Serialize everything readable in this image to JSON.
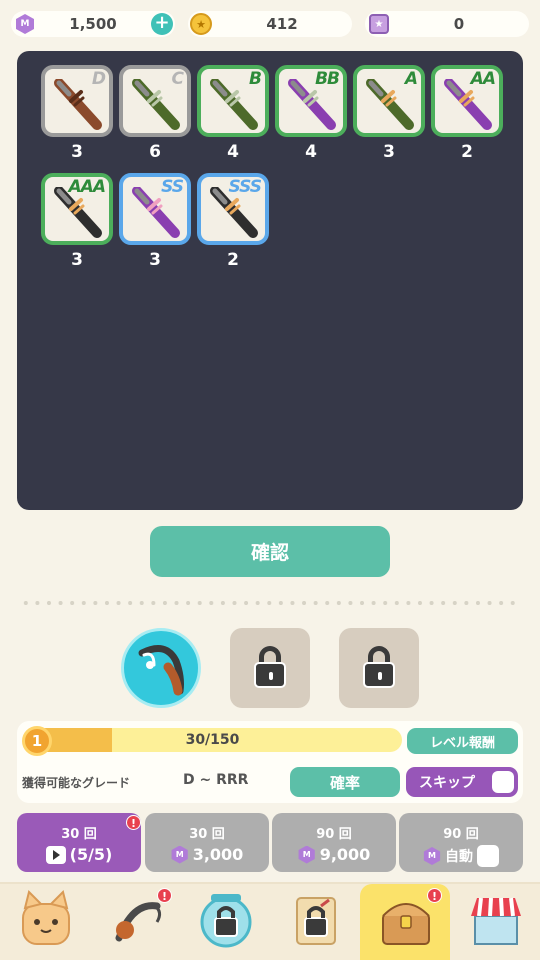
{
  "currency": {
    "gems": "1,500",
    "gem_symbol": "M",
    "coins": "412",
    "tickets": "0"
  },
  "results": [
    {
      "grade": "D",
      "count": "3",
      "frame": "gray",
      "color": "#8b4a2c",
      "band": "#5a2e1a"
    },
    {
      "grade": "C",
      "count": "6",
      "frame": "gray",
      "color": "#4d6a2a",
      "band": "#b9c7a8"
    },
    {
      "grade": "B",
      "count": "4",
      "frame": "green",
      "color": "#4d6a2a",
      "band": "#b9c7a8"
    },
    {
      "grade": "BB",
      "count": "4",
      "frame": "green",
      "color": "#8a3fb0",
      "band": "#b9c7a8"
    },
    {
      "grade": "A",
      "count": "3",
      "frame": "green",
      "color": "#4d6a2a",
      "band": "#e8a85c"
    },
    {
      "grade": "AA",
      "count": "2",
      "frame": "green",
      "color": "#8a3fb0",
      "band": "#e8a85c"
    },
    {
      "grade": "AAA",
      "count": "3",
      "frame": "green",
      "color": "#2e2e2e",
      "band": "#e8a85c"
    },
    {
      "grade": "SS",
      "count": "3",
      "frame": "blue",
      "color": "#8a3fb0",
      "band": "#f0a0c0"
    },
    {
      "grade": "SSS",
      "count": "2",
      "frame": "blue",
      "color": "#2e2e2e",
      "band": "#e8a85c"
    }
  ],
  "confirm_label": "確認",
  "level": {
    "number": "1",
    "progress_text": "30/150",
    "progress_fraction": 0.2,
    "reward_label": "レベル報酬"
  },
  "grade_info": {
    "label": "獲得可能なグレード",
    "range": "D ~ RRR",
    "rate_label": "確率",
    "skip_label": "スキップ"
  },
  "draw_options": [
    {
      "count_label": "30 回",
      "cost": "(5/5)",
      "style": "purple",
      "kind": "ad",
      "alert": true
    },
    {
      "count_label": "30 回",
      "cost": "3,000",
      "style": "gray",
      "kind": "gem",
      "alert": false
    },
    {
      "count_label": "90 回",
      "cost": "9,000",
      "style": "gray",
      "kind": "gem",
      "alert": false
    },
    {
      "count_label": "90 回",
      "cost": "自動",
      "style": "gray",
      "kind": "auto",
      "alert": false
    }
  ],
  "alert_mark": "!",
  "nav": [
    {
      "name": "cat",
      "locked": false,
      "alert": false,
      "active": false
    },
    {
      "name": "rod",
      "locked": false,
      "alert": true,
      "active": false
    },
    {
      "name": "fishbowl",
      "locked": true,
      "alert": false,
      "active": false
    },
    {
      "name": "scroll",
      "locked": true,
      "alert": false,
      "active": false
    },
    {
      "name": "treasure-chest",
      "locked": false,
      "alert": true,
      "active": true
    },
    {
      "name": "shop",
      "locked": false,
      "alert": false,
      "active": false
    }
  ]
}
